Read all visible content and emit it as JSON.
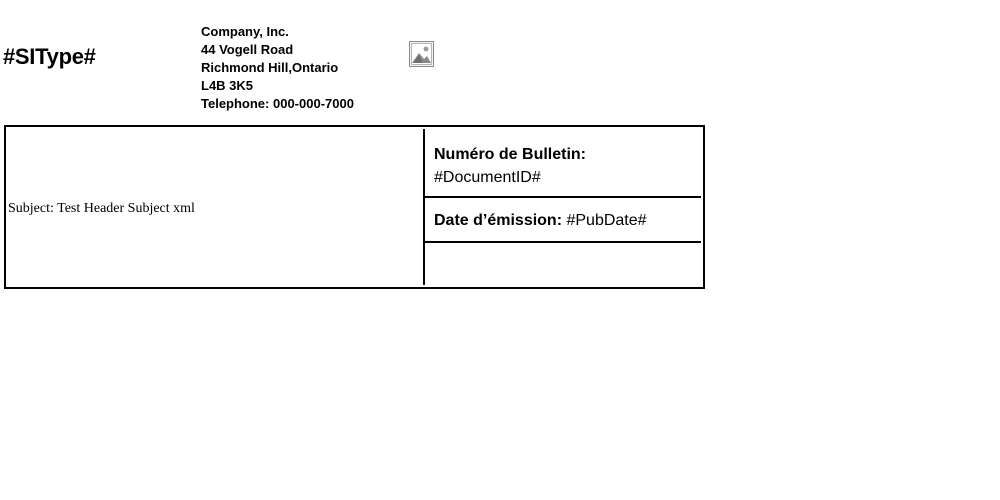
{
  "header": {
    "si_type": "#SIType#",
    "company": {
      "name": "Company, Inc.",
      "street": "44 Vogell Road",
      "city": "Richmond Hill,Ontario",
      "postal": "L4B 3K5",
      "telephone": "Telephone: 000-000-7000"
    },
    "logo_icon": "image-placeholder-icon"
  },
  "bulletin": {
    "subject": "Subject: Test Header Subject xml",
    "number_label": "Numéro de Bulletin:",
    "number_value": "#DocumentID#",
    "date_label": "Date d’émission:",
    "date_value": "#PubDate#",
    "empty_cell": ""
  }
}
